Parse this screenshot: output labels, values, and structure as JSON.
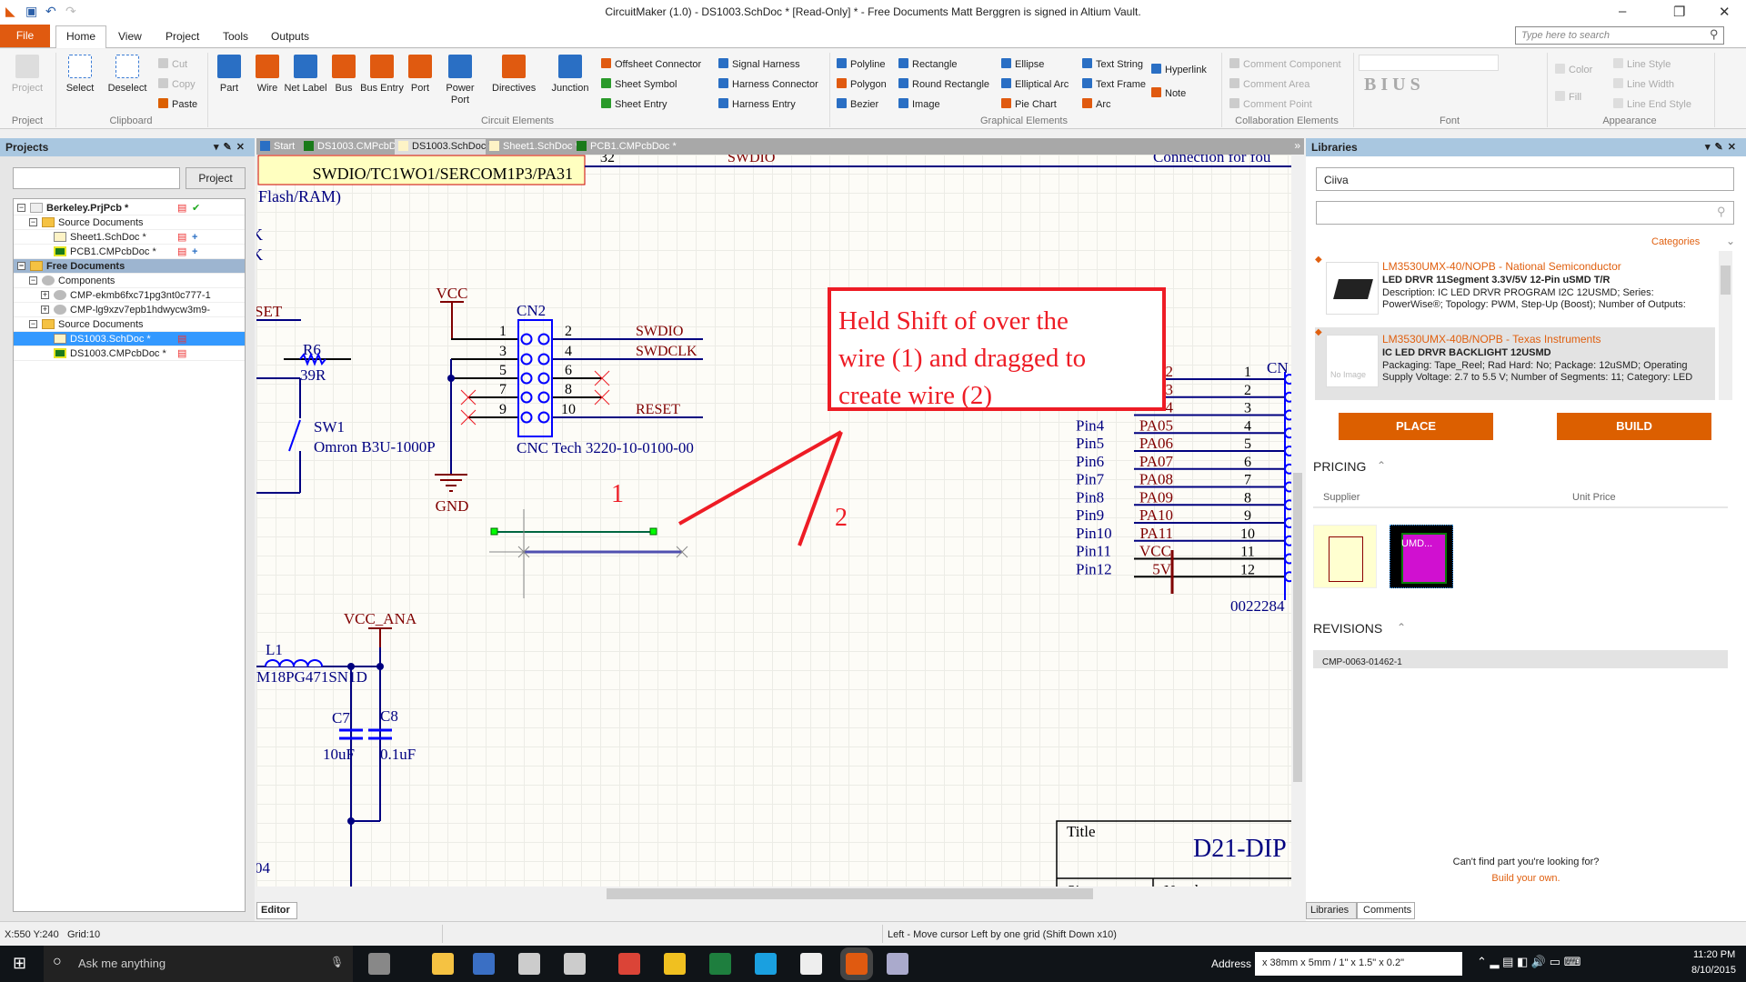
{
  "window": {
    "title": "CircuitMaker (1.0) - DS1003.SchDoc * [Read-Only] * - Free Documents Matt Berggren is signed in Altium Vault.",
    "minimize": "–",
    "restore": "❐",
    "close": "✕"
  },
  "menu": {
    "file": "File",
    "tabs": [
      "Home",
      "View",
      "Project",
      "Tools",
      "Outputs"
    ],
    "search_placeholder": "Type here to search"
  },
  "ribbon": {
    "project": {
      "button": "Project",
      "label": "Project"
    },
    "clipboard": {
      "select": "Select",
      "deselect": "Deselect",
      "cut": "Cut",
      "copy": "Copy",
      "paste": "Paste",
      "label": "Clipboard"
    },
    "circuit": {
      "items": [
        "Part",
        "Wire",
        "Net Label",
        "Bus",
        "Bus Entry",
        "Port",
        "Power Port",
        "Directives",
        "Junction"
      ],
      "small": [
        "Offsheet Connector",
        "Sheet Symbol",
        "Sheet Entry",
        "Signal Harness",
        "Harness Connector",
        "Harness Entry"
      ],
      "label": "Circuit Elements"
    },
    "graphical": {
      "items": [
        "Polyline",
        "Polygon",
        "Bezier",
        "Rectangle",
        "Round Rectangle",
        "Image",
        "Ellipse",
        "Elliptical Arc",
        "Pie Chart",
        "Text String",
        "Text Frame",
        "Arc",
        "Hyperlink",
        "Note"
      ],
      "label": "Graphical Elements"
    },
    "collab": {
      "items": [
        "Comment Component",
        "Comment Area",
        "Comment Point"
      ],
      "label": "Collaboration Elements"
    },
    "font": {
      "label": "Font",
      "styles": "B I U S"
    },
    "appearance": {
      "items": [
        "Color",
        "Fill",
        "Line Style",
        "Line Width",
        "Line End Style"
      ],
      "label": "Appearance"
    }
  },
  "projects": {
    "title": "Projects",
    "search_value": "",
    "button": "Project",
    "tree": [
      {
        "label": "Berkeley.PrjPcb *",
        "level": 0,
        "bold": true,
        "icon": "project"
      },
      {
        "label": "Source Documents",
        "level": 1,
        "icon": "folder"
      },
      {
        "label": "Sheet1.SchDoc *",
        "level": 2,
        "icon": "sch"
      },
      {
        "label": "PCB1.CMPcbDoc *",
        "level": 2,
        "icon": "pcb"
      },
      {
        "label": "Free Documents",
        "level": 0,
        "bold": true,
        "icon": "folder",
        "highlight": "group"
      },
      {
        "label": "Components",
        "level": 1,
        "icon": "comp"
      },
      {
        "label": "CMP-ekmb6fxc71pg3nt0c777-1",
        "level": 2,
        "icon": "comp"
      },
      {
        "label": "CMP-lg9xzv7epb1hdwycw3m9-",
        "level": 2,
        "icon": "comp"
      },
      {
        "label": "Source Documents",
        "level": 1,
        "icon": "folder"
      },
      {
        "label": "DS1003.SchDoc *",
        "level": 2,
        "icon": "sch",
        "highlight": "selected"
      },
      {
        "label": "DS1003.CMPcbDoc *",
        "level": 2,
        "icon": "pcb"
      }
    ]
  },
  "doc_tabs": [
    "Start",
    "DS1003.CMPcbDoc *",
    "DS1003.SchDoc *",
    "Sheet1.SchDoc *",
    "PCB1.CMPcbDoc *"
  ],
  "schematic": {
    "port_label": "SWDIO/TC1WO1/SERCOM1P3/PA31",
    "top_net": "SWDIO",
    "top_pin": "32",
    "flash": "Flash/RAM)",
    "k1": "K",
    "k2": "K",
    "set": "SET",
    "vcc": "VCC",
    "gnd": "GND",
    "cn2": "CN2",
    "cn2_part": "CNC Tech 3220-10-0100-00",
    "cn2_left_pins": [
      "1",
      "3",
      "5",
      "7",
      "9"
    ],
    "cn2_right_pins": [
      "2",
      "4",
      "6",
      "8",
      "10"
    ],
    "nets": {
      "swdio": "SWDIO",
      "swdclk": "SWDCLK",
      "reset": "RESET"
    },
    "r6": "R6",
    "r6_val": "39R",
    "sw1": "SW1",
    "sw1_part": "Omron B3U-1000P",
    "vcc_ana": "VCC_ANA",
    "l1": "L1",
    "l1_part": "M18PG471SN1D",
    "c7": "C7",
    "c7_val": "10uF",
    "c8": "C8",
    "c8_val": "0.1uF",
    "d4": "04",
    "conn_note": "Connection for fou",
    "cn_right": "CN",
    "cn_right_part": "0022284",
    "pin_names": [
      "Pin4",
      "Pin5",
      "Pin6",
      "Pin7",
      "Pin8",
      "Pin9",
      "Pin10",
      "Pin11",
      "Pin12"
    ],
    "pa_nets": [
      "2",
      "3",
      "4",
      "PA05",
      "PA06",
      "PA07",
      "PA08",
      "PA09",
      "PA10",
      "PA11",
      "VCC",
      "5V"
    ],
    "pin_numbers": [
      "1",
      "2",
      "3",
      "4",
      "5",
      "6",
      "7",
      "8",
      "9",
      "10",
      "11",
      "12"
    ],
    "title_block": {
      "title": "Title",
      "value": "D21-DIP",
      "size": "Size",
      "number": "Number"
    },
    "annotation": {
      "lines": [
        "Held Shift of over the",
        "wire (1) and dragged to",
        "create wire (2)"
      ],
      "marker1": "1",
      "marker2": "2"
    }
  },
  "editor_tab": "Editor",
  "libraries": {
    "title": "Libraries",
    "source": "Ciiva",
    "search_value": "",
    "categories": "Categories",
    "results": [
      {
        "title": "LM3530UMX-40/NOPB - National Semiconductor",
        "subtitle": "LED DRVR 11Segment 3.3V/5V 12-Pin uSMD T/R",
        "desc1": "Description: IC LED DRVR PROGRAM I2C 12USMD; Series:",
        "desc2": "PowerWise®; Topology: PWM, Step-Up (Boost); Number of Outputs:"
      },
      {
        "title": "LM3530UMX-40B/NOPB - Texas Instruments",
        "subtitle": "IC LED DRVR BACKLIGHT 12USMD",
        "desc1": "Packaging: Tape_Reel; Rad Hard: No; Package: 12uSMD; Operating",
        "desc2": "Supply Voltage: 2.7 to 5.5 V; Number of Segments: 11; Category: LED",
        "no_image": "No Image"
      }
    ],
    "place": "PLACE",
    "build": "BUILD",
    "pricing": "PRICING",
    "supplier": "Supplier",
    "unit_price": "Unit Price",
    "footprint_label": "UMD...",
    "revisions": "REVISIONS",
    "revision": "CMP-0063-01462-1",
    "cant_find": "Can't find part you're looking for?",
    "build_own": "Build your own.",
    "tabs": [
      "Libraries",
      "Comments"
    ]
  },
  "status": {
    "coords": "X:550 Y:240",
    "grid": "Grid:10",
    "hint": "Left - Move cursor Left by one grid (Shift Down x10)"
  },
  "taskbar": {
    "cortana": "Ask me anything",
    "address_label": "Address",
    "address_value": "x 38mm x 5mm / 1\" x 1.5\" x 0.2\"",
    "time": "11:20 PM",
    "date": "8/10/2015"
  },
  "colors": {
    "accent": "#dc5f00",
    "annotation": "#ee1c25",
    "wire": "#000080",
    "power": "#800000",
    "selection": "#3399ff"
  }
}
